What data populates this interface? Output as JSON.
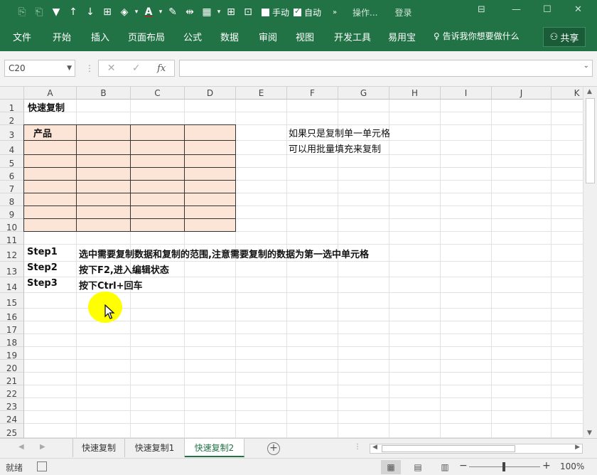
{
  "qat": {
    "manual_label": "手动",
    "auto_label": "自动",
    "search_label": "操作...",
    "login_label": "登录"
  },
  "ribbon": {
    "tabs": [
      {
        "label": "文件"
      },
      {
        "label": "开始"
      },
      {
        "label": "插入"
      },
      {
        "label": "页面布局"
      },
      {
        "label": "公式"
      },
      {
        "label": "数据"
      },
      {
        "label": "审阅"
      },
      {
        "label": "视图"
      },
      {
        "label": "开发工具"
      },
      {
        "label": "易用宝"
      }
    ],
    "tell_me": "告诉我你想要做什么",
    "share": "共享"
  },
  "formula_bar": {
    "name_box": "C20",
    "fx": "fx",
    "value": ""
  },
  "grid": {
    "columns": [
      "A",
      "B",
      "C",
      "D",
      "E",
      "F",
      "G",
      "H",
      "I",
      "J",
      "K"
    ],
    "rows": [
      "1",
      "2",
      "3",
      "4",
      "5",
      "6",
      "7",
      "8",
      "9",
      "10",
      "11",
      "12",
      "13",
      "14",
      "15",
      "16",
      "17",
      "18",
      "19",
      "20",
      "21",
      "22",
      "23",
      "24",
      "25"
    ],
    "cells": {
      "a1": "快速复制",
      "a3": "产品",
      "f3": "如果只是复制单一单元格",
      "f4": "可以用批量填充来复制",
      "a12": "Step1",
      "b12": "选中需要复制数据和复制的范围,注意需要复制的数据为第一选中单元格",
      "a13": "Step2",
      "b13": "按下F2,进入编辑状态",
      "a14": "Step3",
      "b14": "按下Ctrl+回车"
    },
    "fill_color": "#fce4d6"
  },
  "sheets": {
    "tabs": [
      {
        "label": "快速复制",
        "active": false
      },
      {
        "label": "快速复制1",
        "active": false
      },
      {
        "label": "快速复制2",
        "active": true
      }
    ]
  },
  "status": {
    "ready": "就绪",
    "zoom": "100%"
  },
  "colors": {
    "brand": "#217346"
  }
}
